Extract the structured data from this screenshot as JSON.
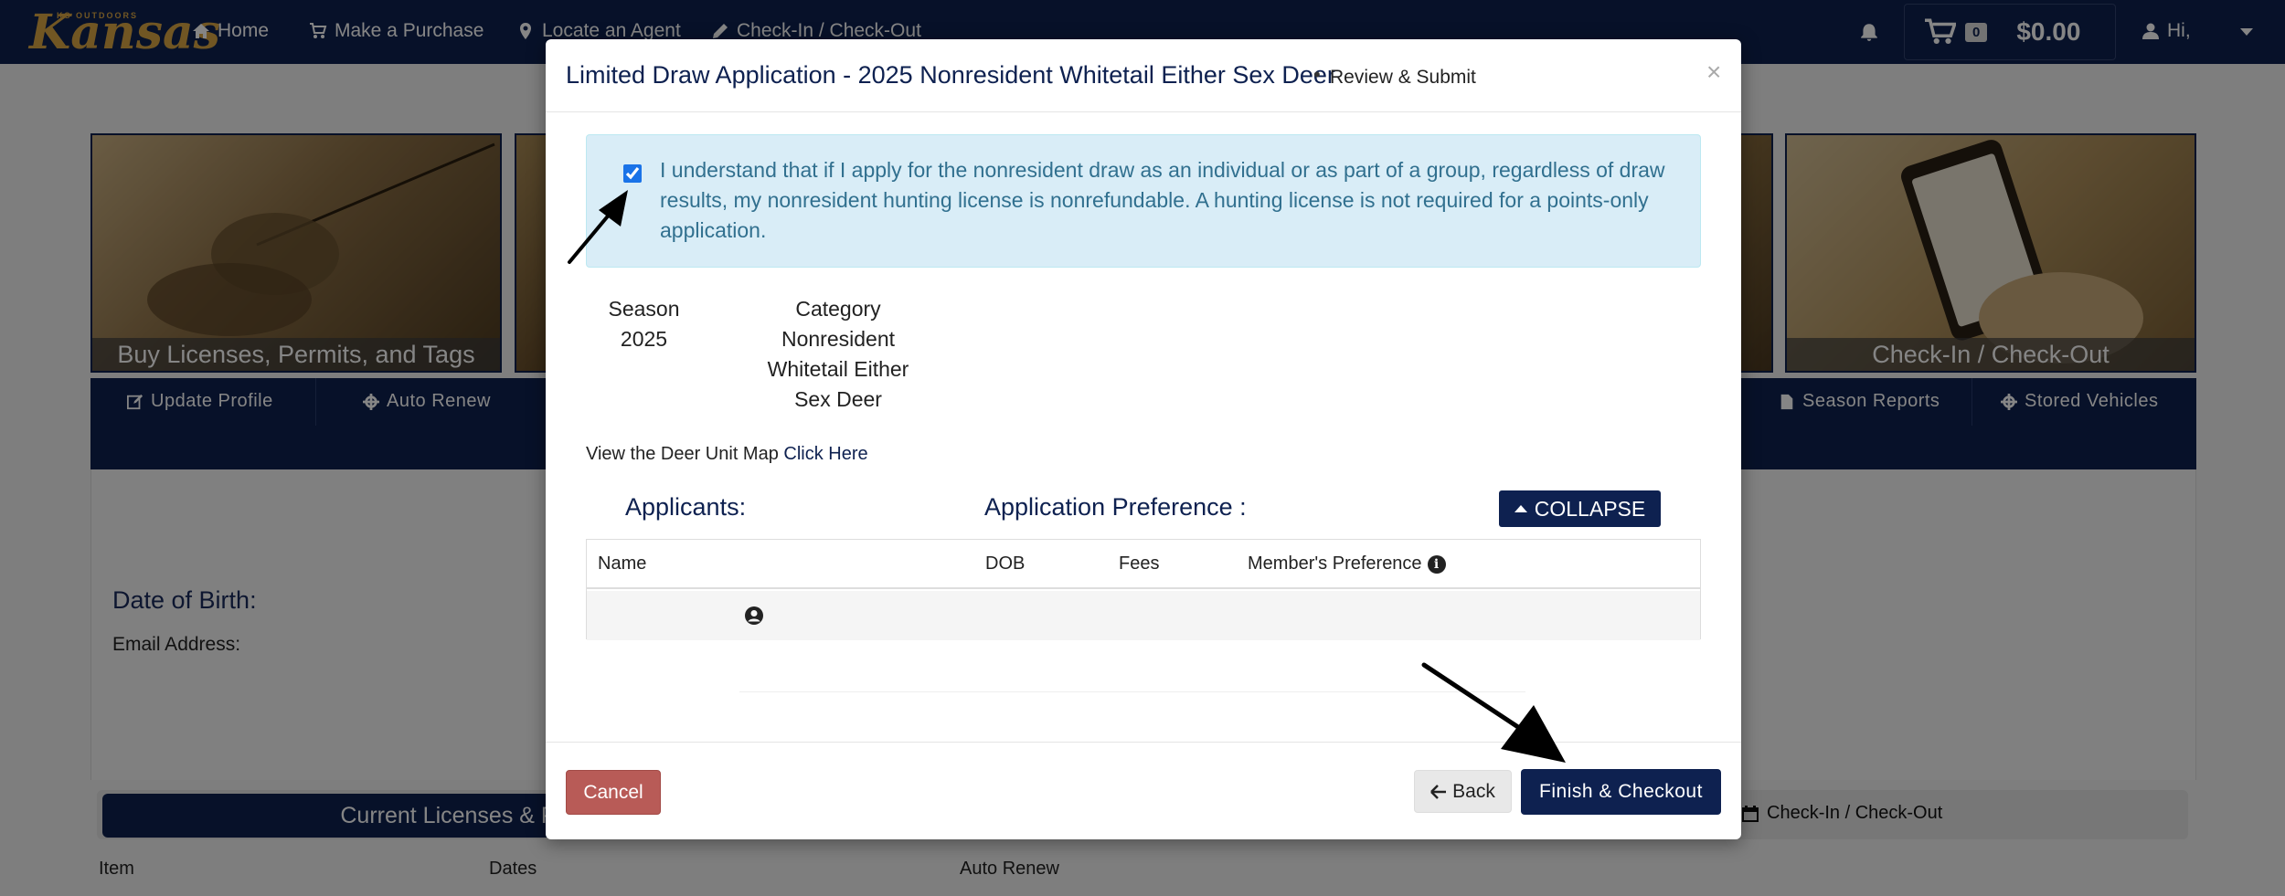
{
  "logo": {
    "small": "KS OUTDOORS",
    "big": "Kansas"
  },
  "nav": {
    "home": "Home",
    "purchase": "Make a Purchase",
    "agent": "Locate an Agent",
    "checkin": "Check-In / Check-Out",
    "cart_count": "0",
    "cart_total": "$0.00",
    "greeting": "Hi,"
  },
  "banners": {
    "left_caption": "Buy Licenses, Permits, and Tags",
    "right_caption": "Check-In / Check-Out"
  },
  "subnav": {
    "update_profile": "Update Profile",
    "auto_renew": "Auto Renew",
    "season_reports": "Season Reports",
    "stored_vehicles": "Stored Vehicles"
  },
  "profile": {
    "dob_label": "Date of Birth:",
    "email_label": "Email Address:"
  },
  "tabs": {
    "current": "Current Licenses & Perm",
    "checkin": "Check-In / Check-Out"
  },
  "bg_table": {
    "item": "Item",
    "dates": "Dates",
    "auto_renew": "Auto Renew"
  },
  "modal": {
    "title": "Limited Draw Application - 2025 Nonresident Whitetail Either Sex Deer",
    "dot": "•",
    "subtitle": "Review & Submit",
    "close": "×",
    "alert_text": "I understand that if I apply for the nonresident draw as an individual or as part of a group, regardless of draw results, my nonresident hunting license is nonrefundable. A hunting license is not required for a points-only application.",
    "season_label": "Season",
    "season_value": "2025",
    "category_label": "Category",
    "category_value": "Nonresident Whitetail Either Sex Deer",
    "map_text": "View the Deer Unit Map",
    "map_link": "Click Here",
    "applicants_label": "Applicants:",
    "preference_label": "Application Preference :",
    "collapse_label": "COLLAPSE",
    "table_headers": {
      "name": "Name",
      "dob": "DOB",
      "fees": "Fees",
      "member_pref": "Member's Preference"
    },
    "cancel_label": "Cancel",
    "back_label": "Back",
    "finish_label": "Finish & Checkout"
  }
}
